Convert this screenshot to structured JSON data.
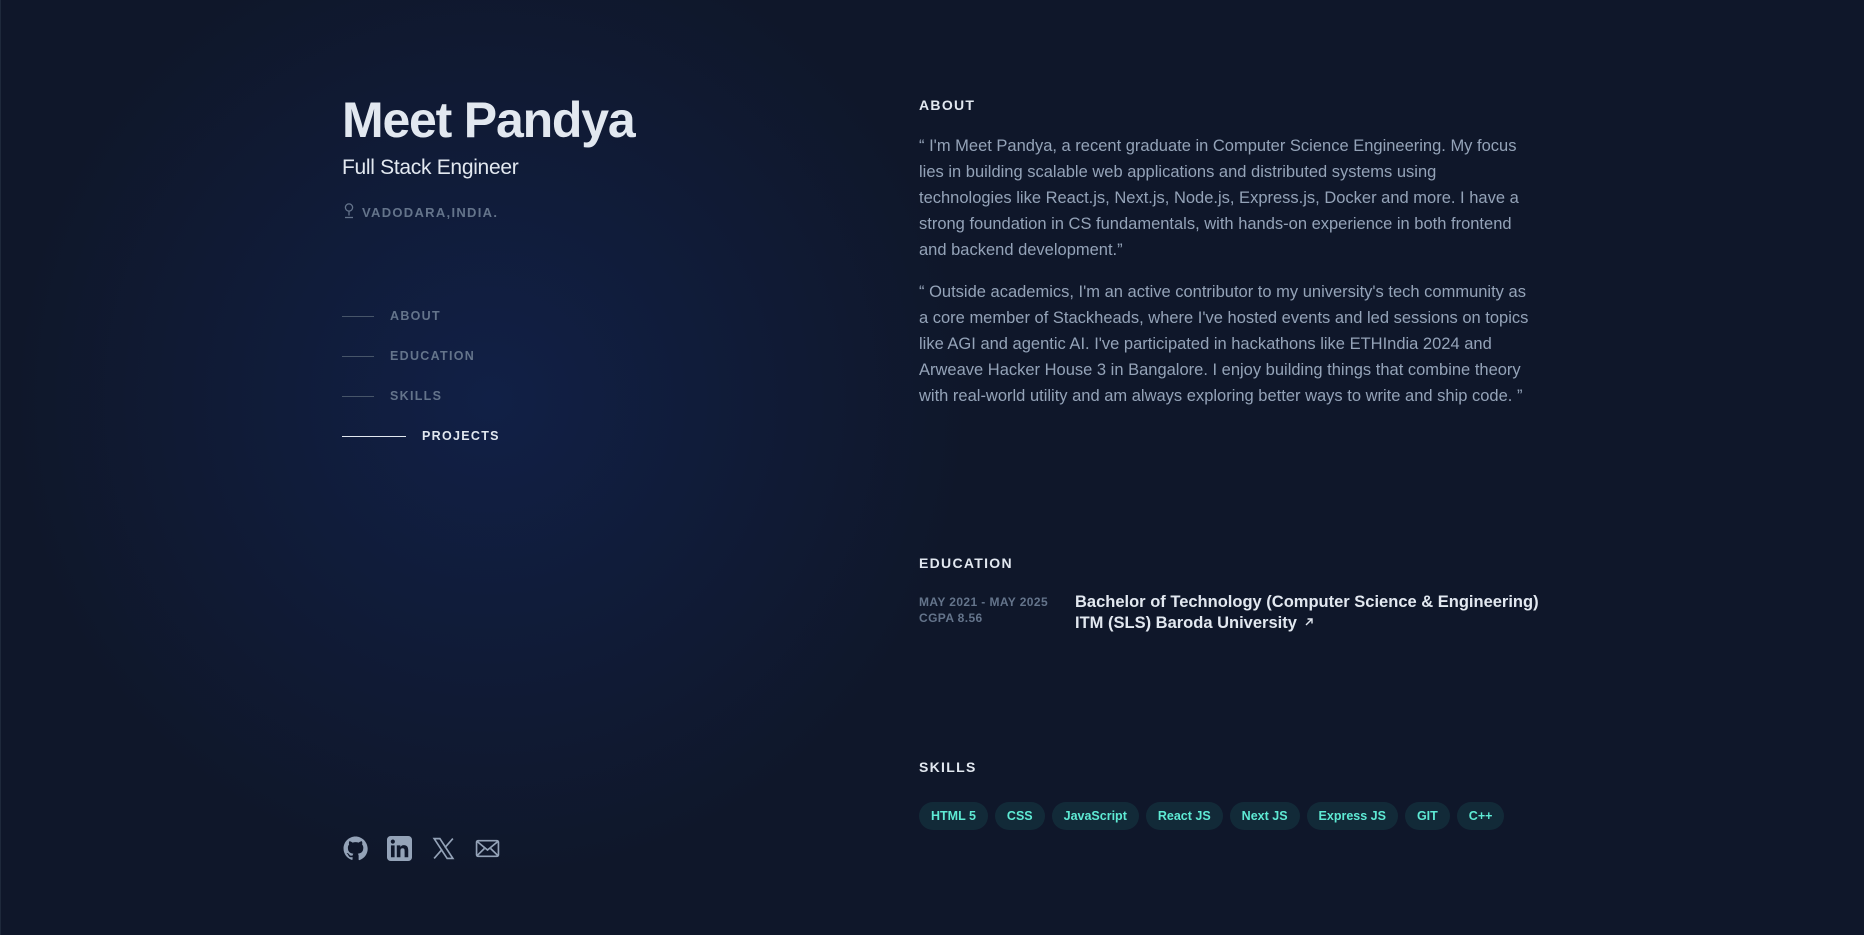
{
  "header": {
    "name": "Meet Pandya",
    "role": "Full Stack Engineer",
    "location": "VADODARA,INDIA."
  },
  "nav": {
    "items": [
      {
        "label": "ABOUT",
        "active": false
      },
      {
        "label": "EDUCATION",
        "active": false
      },
      {
        "label": "SKILLS",
        "active": false
      },
      {
        "label": "PROJECTS",
        "active": true
      }
    ]
  },
  "socials": [
    "github-icon",
    "linkedin-icon",
    "x-icon",
    "mail-icon"
  ],
  "about": {
    "title": "ABOUT",
    "paragraphs": [
      "“ I'm Meet Pandya, a recent graduate in Computer Science Engineering. My focus lies in building scalable web applications and distributed systems using technologies like React.js, Next.js, Node.js, Express.js, Docker and more. I have a strong foundation in CS fundamentals, with hands-on experience in both frontend and backend development.”",
      "“ Outside academics, I'm an active contributor to my university's tech community as a core member of Stackheads, where I've hosted events and led sessions on topics like AGI and agentic AI. I've participated in hackathons like ETHIndia 2024 and Arweave Hacker House 3 in Bangalore. I enjoy building things that combine theory with real-world utility and am always exploring better ways to write and ship code. ”"
    ]
  },
  "education": {
    "title": "EDUCATION",
    "dates": "MAY 2021 - MAY 2025",
    "cgpa": "CGPA 8.56",
    "degree": "Bachelor of Technology (Computer Science & Engineering)",
    "university": "ITM (SLS) Baroda University"
  },
  "skills": {
    "title": "SKILLS",
    "tags": [
      "HTML 5",
      "CSS",
      "JavaScript",
      "React JS",
      "Next JS",
      "Express JS",
      "GIT",
      "C++"
    ]
  },
  "colors": {
    "background": "#0f172a",
    "heading": "#e2e8f0",
    "body_text": "#94a3b8",
    "muted": "#64748b",
    "tag_text": "#5eead4"
  }
}
